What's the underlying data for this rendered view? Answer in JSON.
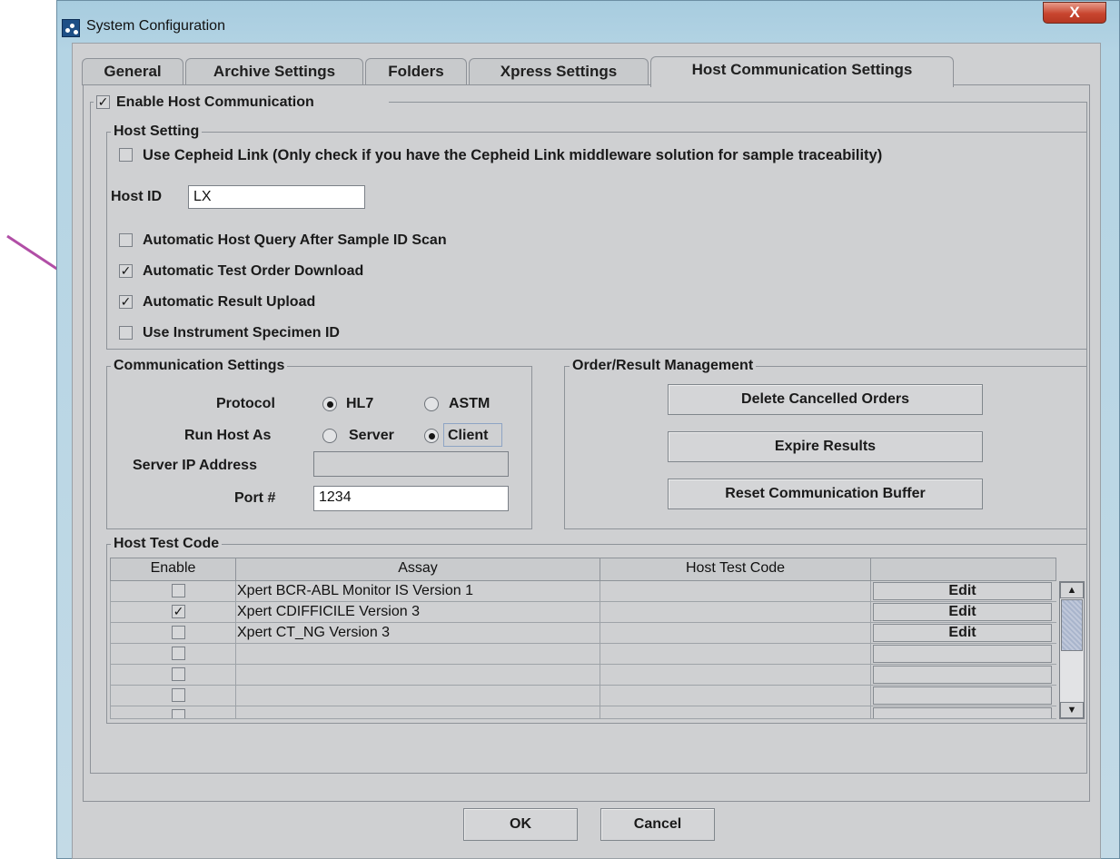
{
  "window": {
    "title": "System Configuration",
    "close_label": "X"
  },
  "tabs": [
    {
      "label": "General"
    },
    {
      "label": "Archive Settings"
    },
    {
      "label": "Folders"
    },
    {
      "label": "Xpress Settings"
    },
    {
      "label": "Host Communication Settings",
      "active": true
    }
  ],
  "enable_host": {
    "label": "Enable Host Communication",
    "checked": true
  },
  "host_setting": {
    "legend": "Host Setting",
    "cepheid_link": {
      "label": "Use Cepheid Link (Only check if you have the Cepheid Link middleware solution for sample traceability)",
      "checked": false
    },
    "host_id": {
      "label": "Host ID",
      "value": "LX"
    },
    "options": [
      {
        "label": "Automatic Host Query After Sample ID Scan",
        "checked": false
      },
      {
        "label": "Automatic Test Order Download",
        "checked": true
      },
      {
        "label": "Automatic Result Upload",
        "checked": true
      },
      {
        "label": "Use Instrument Specimen ID",
        "checked": false
      }
    ]
  },
  "communication": {
    "legend": "Communication Settings",
    "protocol_label": "Protocol",
    "protocol_options": [
      "HL7",
      "ASTM"
    ],
    "protocol_selected": "HL7",
    "run_host_label": "Run Host As",
    "run_host_options": [
      "Server",
      "Client"
    ],
    "run_host_selected": "Client",
    "server_ip_label": "Server IP Address",
    "server_ip_value": "",
    "port_label": "Port #",
    "port_value": "1234"
  },
  "order_result": {
    "legend": "Order/Result Management",
    "buttons": [
      "Delete Cancelled Orders",
      "Expire Results",
      "Reset Communication Buffer"
    ]
  },
  "host_test_code": {
    "legend": "Host Test Code",
    "columns": [
      "Enable",
      "Assay",
      "Host Test Code",
      ""
    ],
    "rows": [
      {
        "enabled": false,
        "assay": "Xpert BCR-ABL Monitor IS Version 1",
        "code": "",
        "action": "Edit"
      },
      {
        "enabled": true,
        "assay": "Xpert CDIFFICILE Version 3",
        "code": "",
        "action": "Edit"
      },
      {
        "enabled": false,
        "assay": "Xpert CT_NG Version 3",
        "code": "",
        "action": "Edit"
      },
      {
        "enabled": false,
        "assay": "",
        "code": "",
        "action": ""
      },
      {
        "enabled": false,
        "assay": "",
        "code": "",
        "action": ""
      },
      {
        "enabled": false,
        "assay": "",
        "code": "",
        "action": ""
      },
      {
        "enabled": false,
        "assay": "",
        "code": "",
        "action": ""
      }
    ]
  },
  "footer": {
    "ok_label": "OK",
    "cancel_label": "Cancel"
  },
  "colors": {
    "annotation_arrow": "#b14ea6",
    "close_button": "#c8452f"
  },
  "checkmark": "✓"
}
